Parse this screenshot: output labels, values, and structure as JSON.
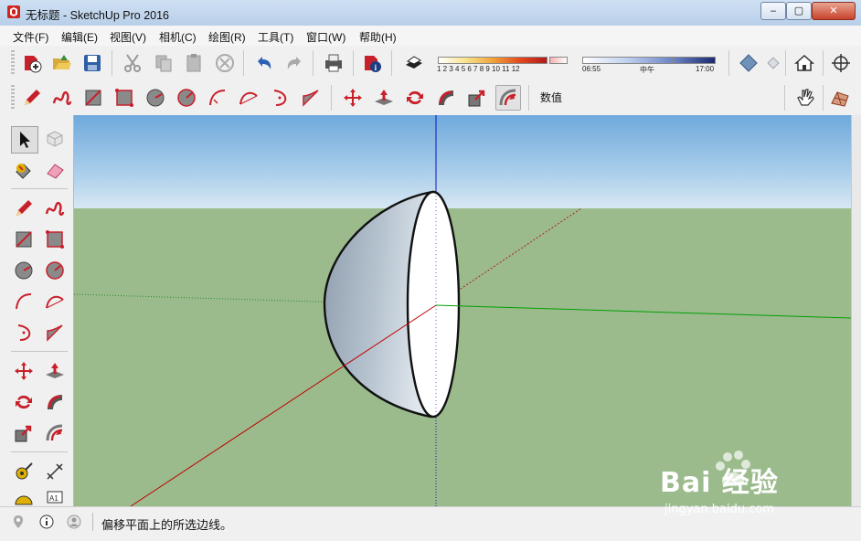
{
  "window": {
    "title": "无标题 - SketchUp Pro 2016",
    "minimize_label": "‒",
    "maximize_label": "▢",
    "close_label": "✕"
  },
  "menu": [
    "文件(F)",
    "编辑(E)",
    "视图(V)",
    "相机(C)",
    "绘图(R)",
    "工具(T)",
    "窗口(W)",
    "帮助(H)"
  ],
  "shadow_settings": {
    "month_ticks": "1  2  3  4  5  6  7  8  9  10 11 12",
    "time_start": "06:55",
    "time_mid": "中午",
    "time_end": "17:00"
  },
  "measurements": {
    "label": "数值"
  },
  "status": {
    "message": "偏移平面上的所选边线。"
  },
  "watermark": {
    "text": "Bai 经验",
    "url": "jingyan.baidu.com"
  },
  "colors": {
    "sky_top": "#6fa9dc",
    "ground": "#9bbb8d",
    "axis_red": "#c00000",
    "axis_green": "#00a000",
    "axis_blue": "#0000c0"
  },
  "icons": {
    "toolbar1": [
      "new-icon",
      "open-icon",
      "save-icon",
      "cut-icon",
      "copy-icon",
      "paste-icon",
      "erase-icon",
      "undo-icon",
      "redo-icon",
      "print-icon",
      "model-info-icon",
      "shadows-icon",
      "fog-icon",
      "house-icon",
      "position-camera-icon"
    ],
    "toolbar2": [
      "pencil-icon",
      "freehand-icon",
      "rectangle-icon",
      "rotated-rectangle-icon",
      "circle-icon",
      "polygon-icon",
      "arc-icon",
      "two-point-arc-icon",
      "three-point-arc-icon",
      "pie-icon",
      "move-icon",
      "push-pull-icon",
      "rotate-icon",
      "follow-me-icon",
      "scale-icon",
      "offset-icon"
    ],
    "left": [
      "select-icon",
      "component-icon",
      "paint-bucket-icon",
      "eraser-icon",
      "line-icon",
      "freehand-icon",
      "rectangle-icon",
      "rotated-rectangle-icon",
      "circle-icon",
      "polygon-icon",
      "arc-icon",
      "two-point-arc-icon",
      "three-point-arc-icon",
      "pie-icon",
      "move-icon",
      "push-pull-icon",
      "rotate-icon",
      "follow-me-icon",
      "scale-icon",
      "offset-icon",
      "tape-measure-icon",
      "dimension-icon",
      "protractor-icon",
      "text-icon"
    ]
  }
}
